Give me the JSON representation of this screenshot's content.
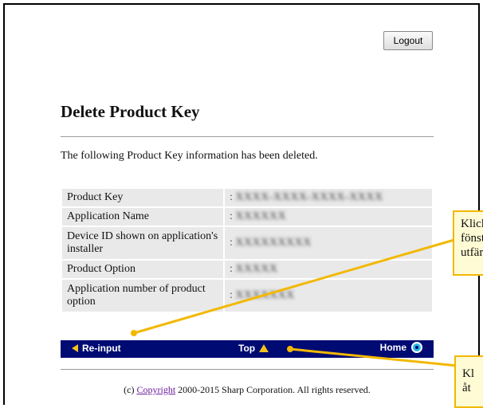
{
  "header": {
    "logout_label": "Logout"
  },
  "page": {
    "title": "Delete Product Key",
    "intro": "The following Product Key information has been deleted."
  },
  "info_table": [
    {
      "label": "Product Key",
      "value": "XXXX-XXXX-XXXX-XXXX"
    },
    {
      "label": "Application Name",
      "value": "XXXXXX"
    },
    {
      "label": "Device ID shown on application's installer",
      "value": "XXXXXXXXX"
    },
    {
      "label": "Product Option",
      "value": "XXXXX"
    },
    {
      "label": "Application number of product option",
      "value": "XXXXXXX"
    }
  ],
  "value_prefix": ":",
  "nav": {
    "reinput_label": "Re-input",
    "top_label": "Top",
    "home_label": "Home"
  },
  "footer": {
    "prefix": "(c) ",
    "link": "Copyright",
    "suffix": " 2000-2015 Sharp Corporation. All rights reserved."
  },
  "callouts": [
    {
      "lines": [
        "Klicka h",
        "fönstret",
        "utfärdad"
      ]
    },
    {
      "lines": [
        "Kl",
        "åt"
      ]
    }
  ],
  "colors": {
    "navbar": "#000a73",
    "callout_border": "#f2b800",
    "callout_fill": "#fffbd5"
  }
}
